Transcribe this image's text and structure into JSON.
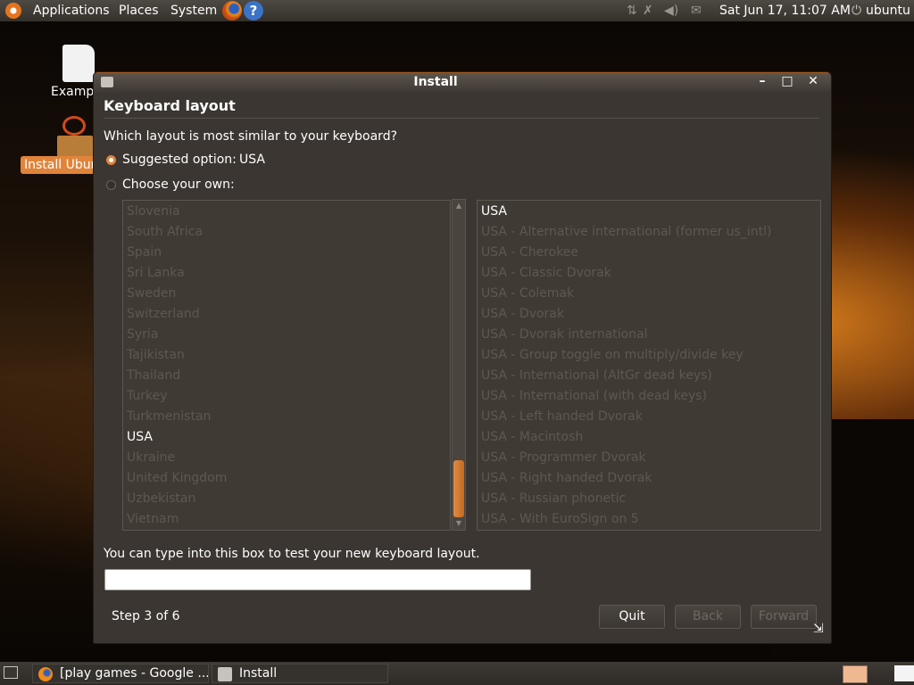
{
  "top_panel": {
    "menu_applications": "Applications",
    "menu_places": "Places",
    "menu_system": "System",
    "help_glyph": "?",
    "datetime": "Sat Jun 17, 11:07 AM",
    "user": "ubuntu",
    "power_glyph": "⏻"
  },
  "desktop": {
    "file_label": "Exampl",
    "installer_label": "Install Ubun"
  },
  "window": {
    "title": "Install",
    "minimize": "–",
    "maximize": "□",
    "close": "✕",
    "heading": "Keyboard layout",
    "question": "Which layout is most similar to your keyboard?",
    "suggested_label": "Suggested option:",
    "suggested_value": "USA",
    "choose_label": "Choose your own:",
    "countries": [
      "Slovenia",
      "South Africa",
      "Spain",
      "Sri Lanka",
      "Sweden",
      "Switzerland",
      "Syria",
      "Tajikistan",
      "Thailand",
      "Turkey",
      "Turkmenistan",
      "USA",
      "Ukraine",
      "United Kingdom",
      "Uzbekistan",
      "Vietnam"
    ],
    "selected_country": "USA",
    "variants": [
      "USA",
      "USA - Alternative international (former us_intl)",
      "USA - Cherokee",
      "USA - Classic Dvorak",
      "USA - Colemak",
      "USA - Dvorak",
      "USA - Dvorak international",
      "USA - Group toggle on multiply/divide key",
      "USA - International (AltGr dead keys)",
      "USA - International (with dead keys)",
      "USA - Left handed Dvorak",
      "USA - Macintosh",
      "USA - Programmer Dvorak",
      "USA - Right handed Dvorak",
      "USA - Russian phonetic",
      "USA - With EuroSign on 5"
    ],
    "selected_variant": "USA",
    "test_label": "You can type into this box to test your new keyboard layout.",
    "test_value": "",
    "step": "Step 3 of 6",
    "quit": "Quit",
    "back": "Back",
    "forward": "Forward"
  },
  "taskbar": {
    "task1": "[play games - Google ...",
    "task2": "Install"
  },
  "colors": {
    "accent": "#e0843a",
    "window_bg": "#3b3631",
    "dim_text": "#5e5850"
  }
}
